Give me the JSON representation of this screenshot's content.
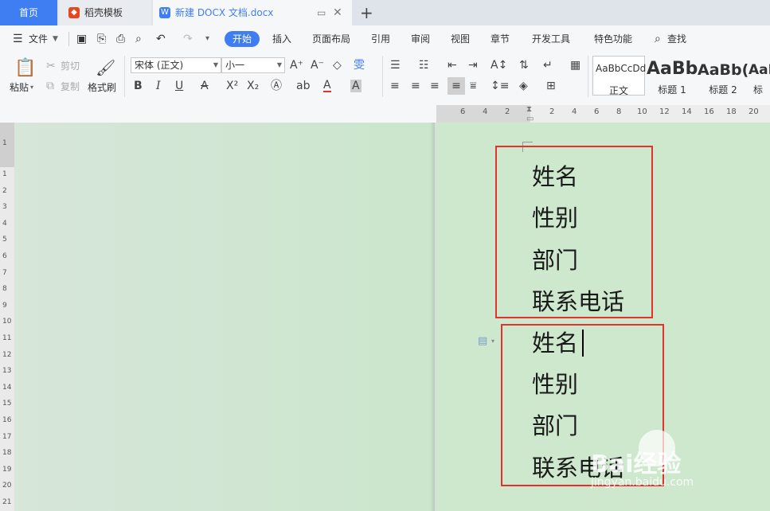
{
  "tabs": {
    "home": "首页",
    "template": "稻壳模板",
    "doc": "新建 DOCX 文档.docx",
    "plus": "+"
  },
  "menu": {
    "file": "文件",
    "start": "开始",
    "insert": "插入",
    "layout": "页面布局",
    "reference": "引用",
    "review": "审阅",
    "view": "视图",
    "chapter": "章节",
    "devtools": "开发工具",
    "features": "特色功能",
    "search": "查找"
  },
  "ribbon": {
    "paste": "粘贴",
    "cut": "剪切",
    "copy": "复制",
    "format_painter": "格式刷",
    "font_name": "宋体 (正文)",
    "font_size": "小一",
    "styles": [
      {
        "sample": "AaBbCcDd",
        "name": "正文"
      },
      {
        "sample": "AaBb",
        "name": "标题 1"
      },
      {
        "sample": "AaBb(",
        "name": "标题 2"
      },
      {
        "sample": "AaI",
        "name": "标"
      }
    ]
  },
  "ruler": {
    "h": [
      "6",
      "4",
      "2",
      "2",
      "4",
      "6",
      "8",
      "10",
      "12",
      "14",
      "16",
      "18",
      "20"
    ],
    "v": [
      "1",
      "1",
      "2",
      "3",
      "4",
      "5",
      "6",
      "7",
      "8",
      "9",
      "10",
      "11",
      "12",
      "13",
      "14",
      "15",
      "16",
      "17",
      "18",
      "19",
      "20",
      "21"
    ]
  },
  "document": {
    "block1": [
      "姓名",
      "性别",
      "部门",
      "联系电话"
    ],
    "block2": [
      "姓名",
      "性别",
      "部门",
      "联系电话"
    ]
  },
  "colors": {
    "accent": "#3f7ef2",
    "highlight_box": "#e53030",
    "page_bg": "#cde8cd"
  },
  "watermark": {
    "main": "Bai经验",
    "sub": "jingyan.baidu.com"
  }
}
